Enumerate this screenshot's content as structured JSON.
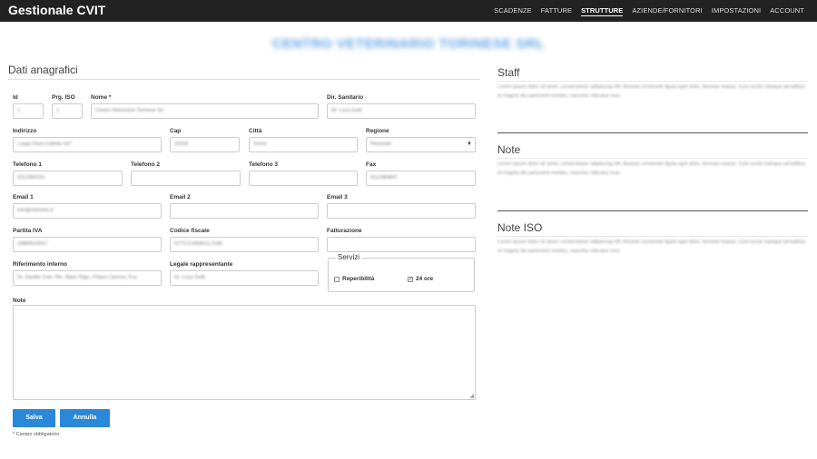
{
  "app": {
    "title": "Gestionale CVIT"
  },
  "nav": {
    "items": [
      {
        "label": "SCADENZE"
      },
      {
        "label": "FATTURE"
      },
      {
        "label": "STRUTTURE"
      },
      {
        "label": "AZIENDE/FORNITORI"
      },
      {
        "label": "IMPOSTAZIONI"
      },
      {
        "label": "ACCOUNT"
      }
    ],
    "active": "STRUTTURE"
  },
  "company_name": "CENTRO VETERINARIO TORINESE SRL",
  "form": {
    "section_title": "Dati anagrafici",
    "fields": {
      "id": {
        "label": "Id",
        "value": "1"
      },
      "prg_iso": {
        "label": "Prg. ISO",
        "value": "1"
      },
      "nome": {
        "label": "Nome *",
        "value": "Centro Veterinario Torinese Srl"
      },
      "dir_sanitario": {
        "label": "Dir. Sanitario",
        "value": "Dr. Luca Gotti"
      },
      "indirizzo": {
        "label": "Indirizzo",
        "value": "Lungo Dora Colletta 147"
      },
      "cap": {
        "label": "Cap",
        "value": "10153"
      },
      "citta": {
        "label": "Città",
        "value": "Torino"
      },
      "regione": {
        "label": "Regione",
        "value": "Piemonte"
      },
      "telefono1": {
        "label": "Telefono 1",
        "value": "0112482319"
      },
      "telefono2": {
        "label": "Telefono 2",
        "value": ""
      },
      "telefono3": {
        "label": "Telefono 3",
        "value": ""
      },
      "fax": {
        "label": "Fax",
        "value": "0112484847"
      },
      "email1": {
        "label": "Email 1",
        "value": "info@ctvtorino.it"
      },
      "email2": {
        "label": "Email 2",
        "value": ""
      },
      "email3": {
        "label": "Email 3",
        "value": ""
      },
      "partita_iva": {
        "label": "Partita IVA",
        "value": "10889510017"
      },
      "codice_fiscale": {
        "label": "Codice fiscale",
        "value": "GTTLCU65B11L219K"
      },
      "fatturazione": {
        "label": "Fatturazione",
        "value": ""
      },
      "riferimento": {
        "label": "Riferimento interno",
        "value": "Dr. Davide Colo, Rin. Mario Rigo, Chiara Canova, Fca"
      },
      "legale": {
        "label": "Legale rappresentante",
        "value": "Dr. Luca Gotti"
      },
      "note": {
        "label": "Note",
        "value": ""
      }
    },
    "servizi": {
      "legend": "Servizi",
      "reperibilita": {
        "label": "Reperibilità",
        "checked": false
      },
      "h24": {
        "label": "24 ore",
        "checked": true
      }
    },
    "buttons": {
      "save": "Salva",
      "cancel": "Annulla"
    },
    "required_note": "* Campo obbligatorio"
  },
  "sidebar": {
    "staff": {
      "title": "Staff",
      "text": "Lorem ipsum dolor sit amet, consectetuer adipiscing elit. Aenean commodo ligula eget dolor. Aenean massa. Cum sociis natoque penatibus et magnis dis parturient montes, nascetur ridiculus mus."
    },
    "note": {
      "title": "Note",
      "text": "Lorem ipsum dolor sit amet, consectetuer adipiscing elit. Aenean commodo ligula eget dolor. Aenean massa. Cum sociis natoque penatibus et magnis dis parturient montes, nascetur ridiculus mus."
    },
    "note_iso": {
      "title": "Note ISO",
      "text": "Lorem ipsum dolor sit amet, consectetuer adipiscing elit. Aenean commodo ligula eget dolor. Aenean massa. Cum sociis natoque penatibus et magnis dis parturient montes, nascetur ridiculus mus."
    }
  },
  "colors": {
    "topbar": "#222222",
    "accent": "#2a88d8",
    "company": "#5ca1e6"
  }
}
